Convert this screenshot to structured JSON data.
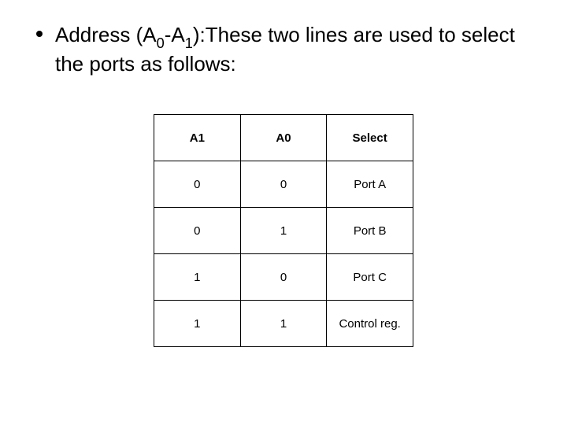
{
  "bullet": {
    "prefix": "Address (A",
    "sub0": "0",
    "mid": "-A",
    "sub1": "1",
    "suffix": "):These two lines are used to select the ports as follows:"
  },
  "table": {
    "headers": {
      "c0": "A1",
      "c1": "A0",
      "c2": "Select"
    },
    "rows": [
      {
        "a1": "0",
        "a0": "0",
        "sel": "Port A"
      },
      {
        "a1": "0",
        "a0": "1",
        "sel": "Port B"
      },
      {
        "a1": "1",
        "a0": "0",
        "sel": "Port C"
      },
      {
        "a1": "1",
        "a0": "1",
        "sel": "Control reg."
      }
    ]
  },
  "chart_data": {
    "type": "table",
    "title": "Address line port selection",
    "columns": [
      "A1",
      "A0",
      "Select"
    ],
    "rows": [
      [
        "0",
        "0",
        "Port A"
      ],
      [
        "0",
        "1",
        "Port B"
      ],
      [
        "1",
        "0",
        "Port C"
      ],
      [
        "1",
        "1",
        "Control reg."
      ]
    ]
  }
}
